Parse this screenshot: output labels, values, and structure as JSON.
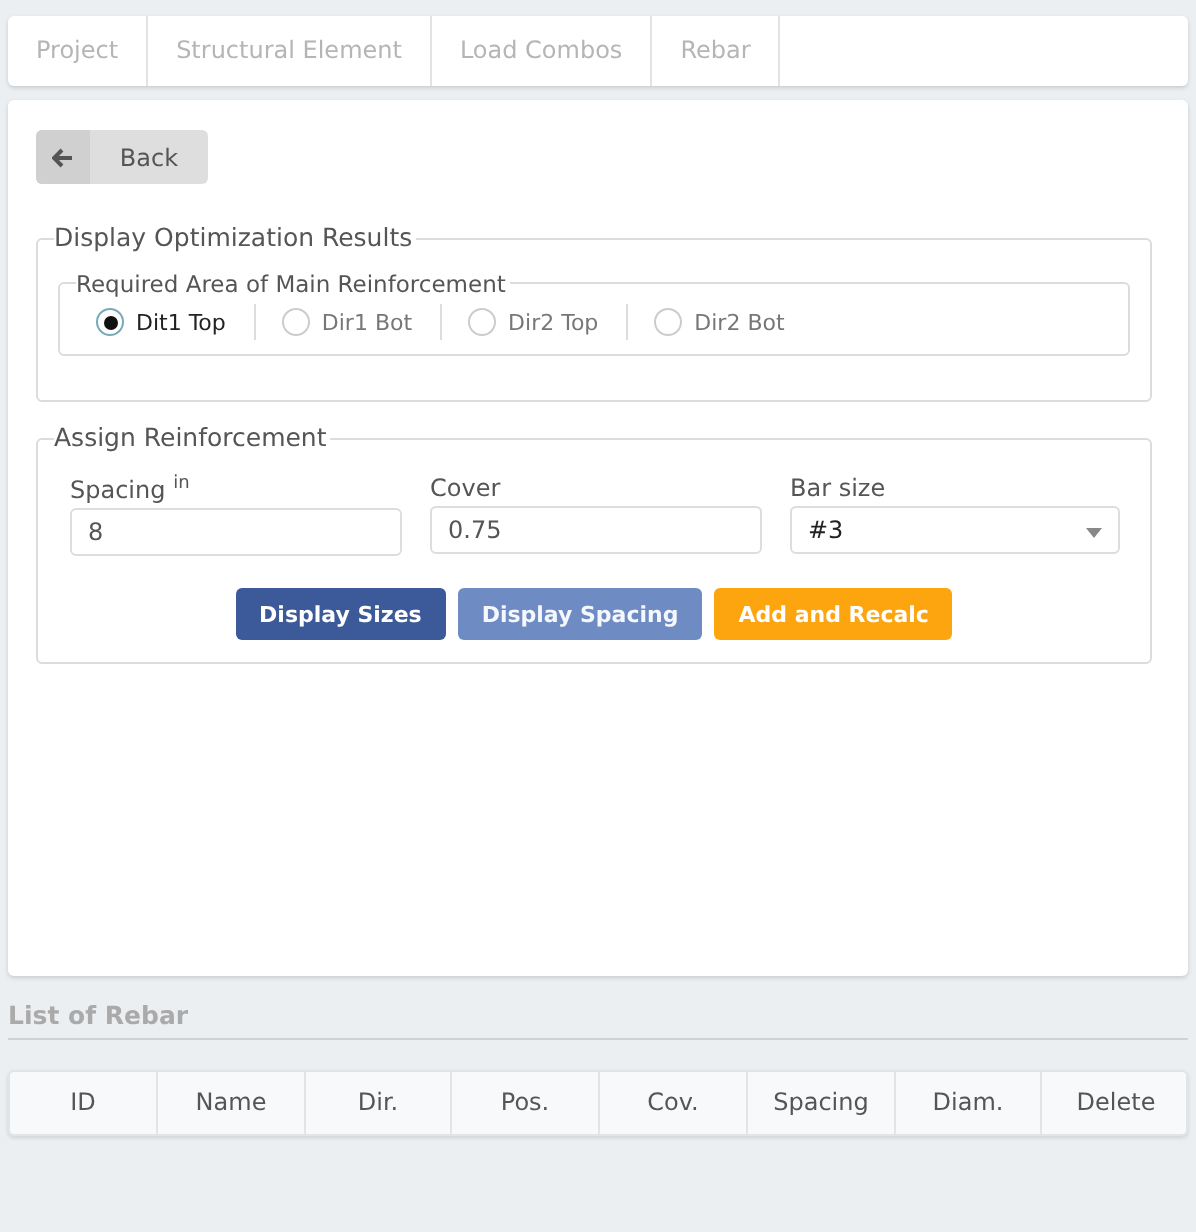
{
  "tabs": [
    {
      "label": "Project",
      "selected": false
    },
    {
      "label": "Structural Element",
      "selected": false
    },
    {
      "label": "Load Combos",
      "selected": false
    },
    {
      "label": "Rebar",
      "selected": false
    }
  ],
  "back_button": {
    "label": "Back"
  },
  "optimization": {
    "title": "Display Optimization Results",
    "group_title": "Required Area of Main Reinforcement",
    "options": [
      {
        "label": "Dit1 Top",
        "selected": true
      },
      {
        "label": "Dir1 Bot",
        "selected": false
      },
      {
        "label": "Dir2 Top",
        "selected": false
      },
      {
        "label": "Dir2 Bot",
        "selected": false
      }
    ]
  },
  "assign": {
    "title": "Assign Reinforcement",
    "fields": [
      {
        "kind": "input",
        "label": "Spacing $^{in}$",
        "value": "8"
      },
      {
        "kind": "input",
        "label": "Cover",
        "value": "0.75"
      },
      {
        "kind": "select",
        "label": "Bar size",
        "value": "#3"
      }
    ],
    "buttons": [
      {
        "label": "Display Sizes",
        "kind": "primary"
      },
      {
        "label": "Display Spacing",
        "kind": "muted"
      },
      {
        "label": "Add and Recalc",
        "kind": "warning"
      }
    ]
  },
  "list": {
    "title": "List of Rebar",
    "columns": [
      "ID",
      "Name",
      "Dir.",
      "Pos.",
      "Cov.",
      "Spacing",
      "Diam.",
      "Delete"
    ]
  }
}
